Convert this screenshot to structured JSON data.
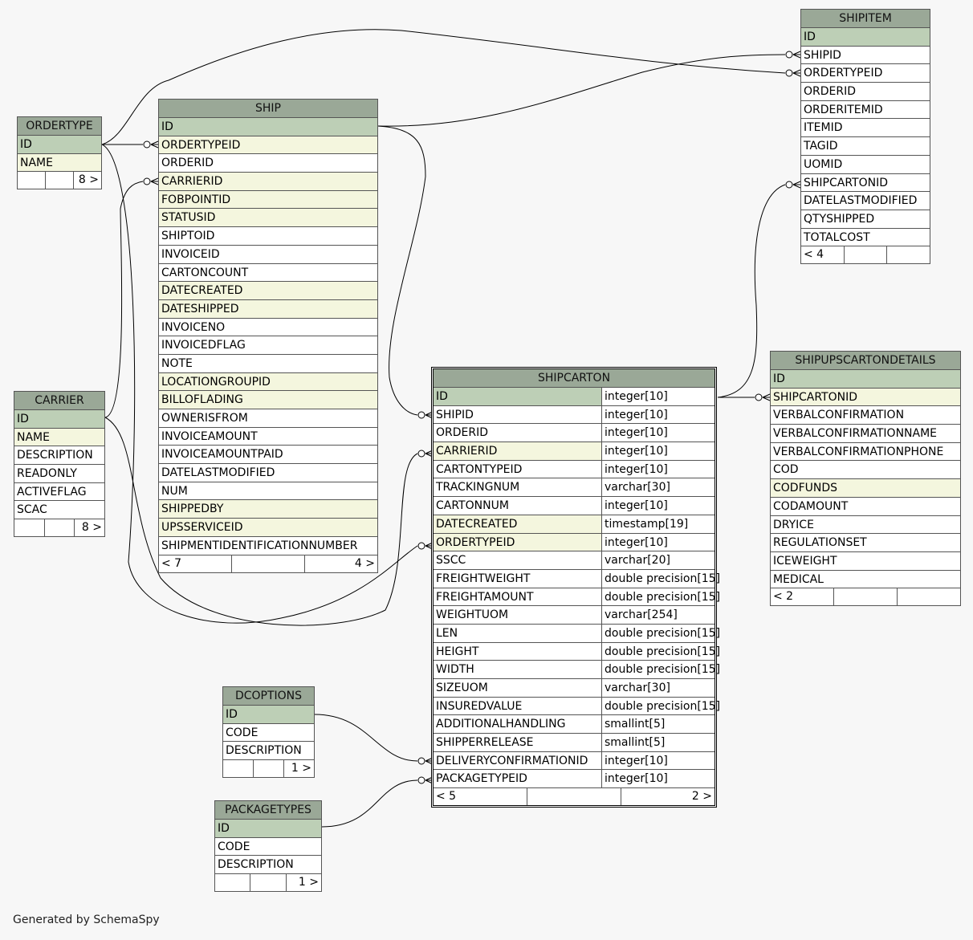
{
  "tables": {
    "shipitem": {
      "title": "SHIPITEM",
      "rows": [
        {
          "name": "ID",
          "kind": "pk"
        },
        {
          "name": "SHIPID",
          "kind": ""
        },
        {
          "name": "ORDERTYPEID",
          "kind": ""
        },
        {
          "name": "ORDERID",
          "kind": ""
        },
        {
          "name": "ORDERITEMID",
          "kind": ""
        },
        {
          "name": "ITEMID",
          "kind": ""
        },
        {
          "name": "TAGID",
          "kind": ""
        },
        {
          "name": "UOMID",
          "kind": ""
        },
        {
          "name": "SHIPCARTONID",
          "kind": ""
        },
        {
          "name": "DATELASTMODIFIED",
          "kind": ""
        },
        {
          "name": "QTYSHIPPED",
          "kind": ""
        },
        {
          "name": "TOTALCOST",
          "kind": ""
        }
      ],
      "footer": [
        "< 4",
        "",
        ""
      ]
    },
    "ordertype": {
      "title": "ORDERTYPE",
      "rows": [
        {
          "name": "ID",
          "kind": "pk"
        },
        {
          "name": "NAME",
          "kind": "fk"
        }
      ],
      "footer": [
        "",
        "",
        "8 >"
      ]
    },
    "ship": {
      "title": "SHIP",
      "rows": [
        {
          "name": "ID",
          "kind": "pk"
        },
        {
          "name": "ORDERTYPEID",
          "kind": "fk"
        },
        {
          "name": "ORDERID",
          "kind": ""
        },
        {
          "name": "CARRIERID",
          "kind": "fk"
        },
        {
          "name": "FOBPOINTID",
          "kind": "fk"
        },
        {
          "name": "STATUSID",
          "kind": "fk"
        },
        {
          "name": "SHIPTOID",
          "kind": ""
        },
        {
          "name": "INVOICEID",
          "kind": ""
        },
        {
          "name": "CARTONCOUNT",
          "kind": ""
        },
        {
          "name": "DATECREATED",
          "kind": "fk"
        },
        {
          "name": "DATESHIPPED",
          "kind": "fk"
        },
        {
          "name": "INVOICENO",
          "kind": ""
        },
        {
          "name": "INVOICEDFLAG",
          "kind": ""
        },
        {
          "name": "NOTE",
          "kind": ""
        },
        {
          "name": "LOCATIONGROUPID",
          "kind": "fk"
        },
        {
          "name": "BILLOFLADING",
          "kind": "fk"
        },
        {
          "name": "OWNERISFROM",
          "kind": ""
        },
        {
          "name": "INVOICEAMOUNT",
          "kind": ""
        },
        {
          "name": "INVOICEAMOUNTPAID",
          "kind": ""
        },
        {
          "name": "DATELASTMODIFIED",
          "kind": ""
        },
        {
          "name": "NUM",
          "kind": ""
        },
        {
          "name": "SHIPPEDBY",
          "kind": "fk"
        },
        {
          "name": "UPSSERVICEID",
          "kind": "fk"
        },
        {
          "name": "SHIPMENTIDENTIFICATIONNUMBER",
          "kind": ""
        }
      ],
      "footer": [
        "< 7",
        "",
        "4 >"
      ]
    },
    "carrier": {
      "title": "CARRIER",
      "rows": [
        {
          "name": "ID",
          "kind": "pk"
        },
        {
          "name": "NAME",
          "kind": "fk"
        },
        {
          "name": "DESCRIPTION",
          "kind": ""
        },
        {
          "name": "READONLY",
          "kind": ""
        },
        {
          "name": "ACTIVEFLAG",
          "kind": ""
        },
        {
          "name": "SCAC",
          "kind": ""
        }
      ],
      "footer": [
        "",
        "",
        "8 >"
      ]
    },
    "shipcarton": {
      "title": "SHIPCARTON",
      "rows": [
        {
          "name": "ID",
          "type": "integer[10]",
          "kind": "pk"
        },
        {
          "name": "SHIPID",
          "type": "integer[10]",
          "kind": ""
        },
        {
          "name": "ORDERID",
          "type": "integer[10]",
          "kind": ""
        },
        {
          "name": "CARRIERID",
          "type": "integer[10]",
          "kind": "fk"
        },
        {
          "name": "CARTONTYPEID",
          "type": "integer[10]",
          "kind": ""
        },
        {
          "name": "TRACKINGNUM",
          "type": "varchar[30]",
          "kind": ""
        },
        {
          "name": "CARTONNUM",
          "type": "integer[10]",
          "kind": ""
        },
        {
          "name": "DATECREATED",
          "type": "timestamp[19]",
          "kind": "fk"
        },
        {
          "name": "ORDERTYPEID",
          "type": "integer[10]",
          "kind": "fk"
        },
        {
          "name": "SSCC",
          "type": "varchar[20]",
          "kind": ""
        },
        {
          "name": "FREIGHTWEIGHT",
          "type": "double precision[15]",
          "kind": ""
        },
        {
          "name": "FREIGHTAMOUNT",
          "type": "double precision[15]",
          "kind": ""
        },
        {
          "name": "WEIGHTUOM",
          "type": "varchar[254]",
          "kind": ""
        },
        {
          "name": "LEN",
          "type": "double precision[15]",
          "kind": ""
        },
        {
          "name": "HEIGHT",
          "type": "double precision[15]",
          "kind": ""
        },
        {
          "name": "WIDTH",
          "type": "double precision[15]",
          "kind": ""
        },
        {
          "name": "SIZEUOM",
          "type": "varchar[30]",
          "kind": ""
        },
        {
          "name": "INSUREDVALUE",
          "type": "double precision[15]",
          "kind": ""
        },
        {
          "name": "ADDITIONALHANDLING",
          "type": "smallint[5]",
          "kind": ""
        },
        {
          "name": "SHIPPERRELEASE",
          "type": "smallint[5]",
          "kind": ""
        },
        {
          "name": "DELIVERYCONFIRMATIONID",
          "type": "integer[10]",
          "kind": ""
        },
        {
          "name": "PACKAGETYPEID",
          "type": "integer[10]",
          "kind": ""
        }
      ],
      "footer": [
        "< 5",
        "",
        "2 >"
      ]
    },
    "shipupscartondetails": {
      "title": "SHIPUPSCARTONDETAILS",
      "rows": [
        {
          "name": "ID",
          "kind": "pk"
        },
        {
          "name": "SHIPCARTONID",
          "kind": "fk"
        },
        {
          "name": "VERBALCONFIRMATION",
          "kind": ""
        },
        {
          "name": "VERBALCONFIRMATIONNAME",
          "kind": ""
        },
        {
          "name": "VERBALCONFIRMATIONPHONE",
          "kind": ""
        },
        {
          "name": "COD",
          "kind": ""
        },
        {
          "name": "CODFUNDS",
          "kind": "fk"
        },
        {
          "name": "CODAMOUNT",
          "kind": ""
        },
        {
          "name": "DRYICE",
          "kind": ""
        },
        {
          "name": "REGULATIONSET",
          "kind": ""
        },
        {
          "name": "ICEWEIGHT",
          "kind": ""
        },
        {
          "name": "MEDICAL",
          "kind": ""
        }
      ],
      "footer": [
        "< 2",
        "",
        ""
      ]
    },
    "dcoptions": {
      "title": "DCOPTIONS",
      "rows": [
        {
          "name": "ID",
          "kind": "pk"
        },
        {
          "name": "CODE",
          "kind": ""
        },
        {
          "name": "DESCRIPTION",
          "kind": ""
        }
      ],
      "footer": [
        "",
        "",
        "1 >"
      ]
    },
    "packagetypes": {
      "title": "PACKAGETYPES",
      "rows": [
        {
          "name": "ID",
          "kind": "pk"
        },
        {
          "name": "CODE",
          "kind": ""
        },
        {
          "name": "DESCRIPTION",
          "kind": ""
        }
      ],
      "footer": [
        "",
        "",
        "1 >"
      ]
    }
  },
  "credit": "Generated by SchemaSpy",
  "colors": {
    "header": "#9aa897",
    "pk": "#bdcfb6",
    "fk": "#f4f6de",
    "background": "#f7f7f7"
  }
}
